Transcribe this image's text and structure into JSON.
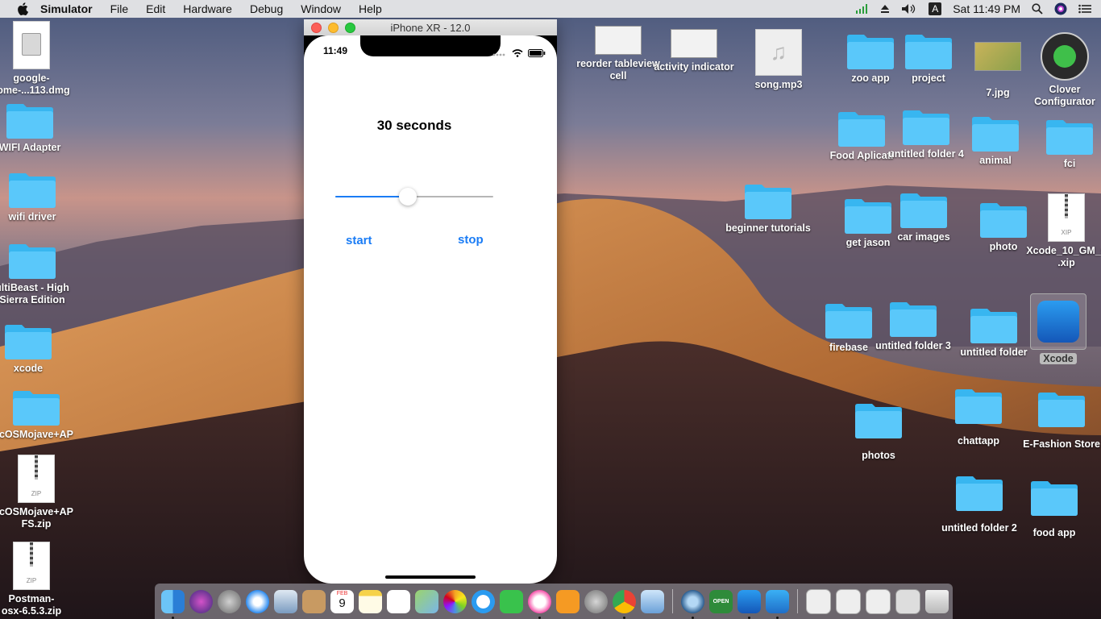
{
  "menubar": {
    "app_name": "Simulator",
    "items": [
      "File",
      "Edit",
      "Hardware",
      "Debug",
      "Window",
      "Help"
    ],
    "clock": "Sat 11:49 PM",
    "input_letter": "A"
  },
  "window": {
    "title": "iPhone XR - 12.0"
  },
  "phone": {
    "status_time": "11:49",
    "timer_label": "30 seconds",
    "slider_fraction": 0.46,
    "start_label": "start",
    "stop_label": "stop",
    "accent_color": "#1a7cf5"
  },
  "desktop": {
    "left_icons": [
      {
        "label1": "google-",
        "label2": "rome-...113.dmg",
        "type": "dmg"
      },
      {
        "label1": "WIFI Adapter",
        "label2": "",
        "type": "folder"
      },
      {
        "label1": "wifi driver",
        "label2": "",
        "type": "folder"
      },
      {
        "label1": "ultiBeast - High",
        "label2": "Sierra Edition",
        "type": "folder"
      },
      {
        "label1": "xcode",
        "label2": "",
        "type": "folder"
      },
      {
        "label1": "cOSMojave+AP",
        "label2": "",
        "type": "folder"
      },
      {
        "label1": "cOSMojave+AP",
        "label2": "FS.zip",
        "type": "zip"
      },
      {
        "label1": "Postman-",
        "label2": "osx-6.5.3.zip",
        "type": "zip"
      }
    ],
    "right_icons": [
      {
        "label1": "reorder tableview",
        "label2": "cell",
        "type": "thumb"
      },
      {
        "label1": "activity indicator",
        "label2": "",
        "type": "thumb"
      },
      {
        "label1": "song.mp3",
        "label2": "",
        "type": "audio"
      },
      {
        "label1": "zoo app",
        "label2": "",
        "type": "folder"
      },
      {
        "label1": "project",
        "label2": "",
        "type": "folder"
      },
      {
        "label1": "7.jpg",
        "label2": "",
        "type": "image"
      },
      {
        "label1": "Clover",
        "label2": "Configurator",
        "type": "app"
      },
      {
        "label1": "Food Aplicati",
        "label2": "",
        "type": "folder"
      },
      {
        "label1": "untitled folder 4",
        "label2": "",
        "type": "folder"
      },
      {
        "label1": "animal",
        "label2": "",
        "type": "folder"
      },
      {
        "label1": "fci",
        "label2": "",
        "type": "folder"
      },
      {
        "label1": "beginner tutorials",
        "label2": "",
        "type": "folder"
      },
      {
        "label1": "get jason",
        "label2": "",
        "type": "folder"
      },
      {
        "label1": "car images",
        "label2": "",
        "type": "folder"
      },
      {
        "label1": "photo",
        "label2": "",
        "type": "folder"
      },
      {
        "label1": "Xcode_10_GM_s",
        "label2": ".xip",
        "type": "zip"
      },
      {
        "label1": "firebase",
        "label2": "",
        "type": "folder"
      },
      {
        "label1": "untitled folder 3",
        "label2": "",
        "type": "folder"
      },
      {
        "label1": "untitled folder",
        "label2": "",
        "type": "folder"
      },
      {
        "label1": "Xcode",
        "label2": "",
        "type": "app"
      },
      {
        "label1": "photos",
        "label2": "",
        "type": "folder"
      },
      {
        "label1": "chattapp",
        "label2": "",
        "type": "folder"
      },
      {
        "label1": "E-Fashion Store",
        "label2": "",
        "type": "folder"
      },
      {
        "label1": "untitled folder 2",
        "label2": "",
        "type": "folder"
      },
      {
        "label1": "food app",
        "label2": "",
        "type": "folder"
      }
    ],
    "file_tags": {
      "zip": "ZIP",
      "xip": "XIP"
    }
  },
  "dock": {
    "apps": [
      "finder",
      "siri",
      "launchpad",
      "safari",
      "mail-stamp",
      "contacts",
      "calendar",
      "notes",
      "reminders",
      "maps",
      "photos",
      "messages",
      "facetime",
      "itunes",
      "ibooks",
      "system-preferences",
      "chrome",
      "preview",
      "quicktime",
      "open-app",
      "xcode",
      "instruments"
    ],
    "calendar_month": "FEB",
    "calendar_day": "9",
    "open_label": "OPEN",
    "right_items": [
      "doc1",
      "doc2",
      "doc3",
      "keyboard",
      "trash"
    ]
  },
  "colors": {
    "folder": "#5ac8fa",
    "folder_dark": "#38b6f0"
  }
}
